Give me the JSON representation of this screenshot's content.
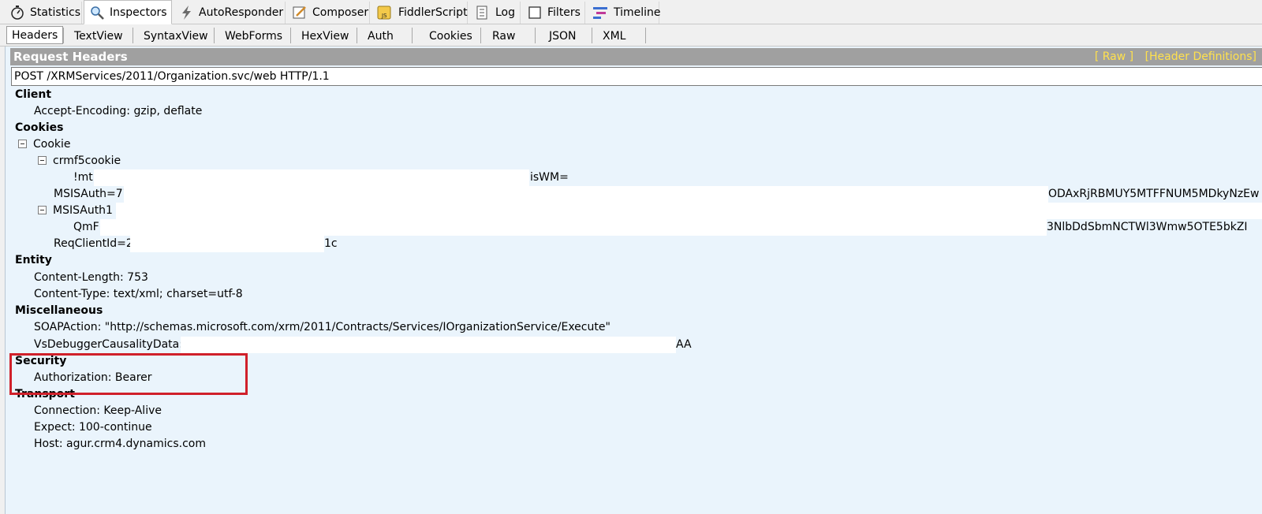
{
  "top_tabs": [
    {
      "label": "Statistics",
      "icon": "stopwatch-icon"
    },
    {
      "label": "Inspectors",
      "icon": "magnifier-icon"
    },
    {
      "label": "AutoResponder",
      "icon": "lightning-icon"
    },
    {
      "label": "Composer",
      "icon": "pencil-icon"
    },
    {
      "label": "FiddlerScript",
      "icon": "script-icon"
    },
    {
      "label": "Log",
      "icon": "log-icon"
    },
    {
      "label": "Filters",
      "icon": "checkbox-icon"
    },
    {
      "label": "Timeline",
      "icon": "timeline-icon"
    }
  ],
  "sub_tabs": [
    "Headers",
    "TextView",
    "SyntaxView",
    "WebForms",
    "HexView",
    "Auth",
    "Cookies",
    "Raw",
    "JSON",
    "XML"
  ],
  "request_headers": {
    "title": "Request Headers",
    "raw_link": "[ Raw ]",
    "definitions_link": "[Header Definitions]",
    "request_line": "POST /XRMServices/2011/Organization.svc/web HTTP/1.1"
  },
  "client": {
    "label": "Client",
    "accept_encoding": "Accept-Encoding: gzip, deflate"
  },
  "cookies": {
    "label": "Cookies",
    "cookie": "Cookie",
    "crmf5cookie": "crmf5cookie",
    "crmf5_value_start": "!mt",
    "crmf5_value_end": "isWM=",
    "msisauth_start": "MSISAuth=77",
    "msisauth_end": "ODAxRjRBMUY5MTFFNUM5MDkyNzEw",
    "msisauth1": "MSISAuth1",
    "msisauth1_value_start": "QmF(",
    "msisauth1_value_end": "3NlbDdSbmNCTWl3Wmw5OTE5bkZI",
    "reqclientid_start": "ReqClientId=2a",
    "reqclientid_end": "1c"
  },
  "entity": {
    "label": "Entity",
    "content_length": "Content-Length: 753",
    "content_type": "Content-Type: text/xml; charset=utf-8"
  },
  "misc": {
    "label": "Miscellaneous",
    "soapaction": "SOAPAction: \"http://schemas.microsoft.com/xrm/2011/Contracts/Services/IOrganizationService/Execute\"",
    "vsdebugger_start": "VsDebuggerCausalityData: uII",
    "vsdebugger_end": "AA"
  },
  "security": {
    "label": "Security",
    "authorization": "Authorization: Bearer"
  },
  "transport": {
    "label": "Transport",
    "connection": "Connection: Keep-Alive",
    "expect": "Expect: 100-continue",
    "host": "Host: agur.crm4.dynamics.com"
  },
  "colors": {
    "header_bar": "#a0a0a0",
    "link_yellow": "#ffe14d",
    "content_bg": "#eaf4fc",
    "highlight_red": "#d0202a"
  }
}
